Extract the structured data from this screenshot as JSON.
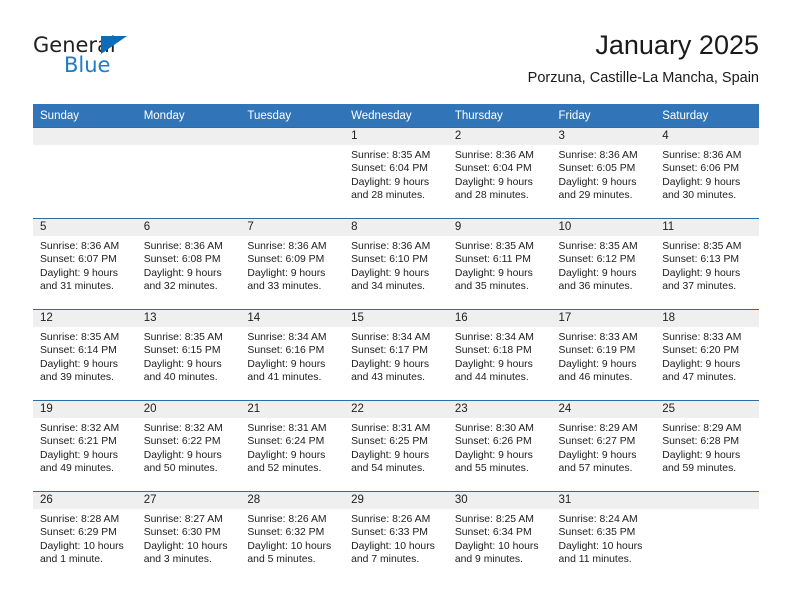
{
  "logo": {
    "text_primary": "General",
    "text_secondary": "Blue",
    "triangle_color": "#0e6cb6",
    "secondary_color": "#1c7cc6"
  },
  "header": {
    "title": "January 2025",
    "subtitle": "Porzuna, Castille-La Mancha, Spain"
  },
  "theme": {
    "header_blue": "#3175b8",
    "row_rule_blue": "#2e6da4",
    "daynum_band": "#efefef",
    "text": "#202020"
  },
  "calendar": {
    "weekday_headers": [
      "Sunday",
      "Monday",
      "Tuesday",
      "Wednesday",
      "Thursday",
      "Friday",
      "Saturday"
    ],
    "weeks": [
      [
        {
          "day": "",
          "sunrise": "",
          "sunset": "",
          "daylight_line1": "",
          "daylight_line2": "",
          "empty": true
        },
        {
          "day": "",
          "sunrise": "",
          "sunset": "",
          "daylight_line1": "",
          "daylight_line2": "",
          "empty": true
        },
        {
          "day": "",
          "sunrise": "",
          "sunset": "",
          "daylight_line1": "",
          "daylight_line2": "",
          "empty": true
        },
        {
          "day": "1",
          "sunrise": "Sunrise: 8:35 AM",
          "sunset": "Sunset: 6:04 PM",
          "daylight_line1": "Daylight: 9 hours",
          "daylight_line2": "and 28 minutes.",
          "empty": false
        },
        {
          "day": "2",
          "sunrise": "Sunrise: 8:36 AM",
          "sunset": "Sunset: 6:04 PM",
          "daylight_line1": "Daylight: 9 hours",
          "daylight_line2": "and 28 minutes.",
          "empty": false
        },
        {
          "day": "3",
          "sunrise": "Sunrise: 8:36 AM",
          "sunset": "Sunset: 6:05 PM",
          "daylight_line1": "Daylight: 9 hours",
          "daylight_line2": "and 29 minutes.",
          "empty": false
        },
        {
          "day": "4",
          "sunrise": "Sunrise: 8:36 AM",
          "sunset": "Sunset: 6:06 PM",
          "daylight_line1": "Daylight: 9 hours",
          "daylight_line2": "and 30 minutes.",
          "empty": false
        }
      ],
      [
        {
          "day": "5",
          "sunrise": "Sunrise: 8:36 AM",
          "sunset": "Sunset: 6:07 PM",
          "daylight_line1": "Daylight: 9 hours",
          "daylight_line2": "and 31 minutes.",
          "empty": false
        },
        {
          "day": "6",
          "sunrise": "Sunrise: 8:36 AM",
          "sunset": "Sunset: 6:08 PM",
          "daylight_line1": "Daylight: 9 hours",
          "daylight_line2": "and 32 minutes.",
          "empty": false
        },
        {
          "day": "7",
          "sunrise": "Sunrise: 8:36 AM",
          "sunset": "Sunset: 6:09 PM",
          "daylight_line1": "Daylight: 9 hours",
          "daylight_line2": "and 33 minutes.",
          "empty": false
        },
        {
          "day": "8",
          "sunrise": "Sunrise: 8:36 AM",
          "sunset": "Sunset: 6:10 PM",
          "daylight_line1": "Daylight: 9 hours",
          "daylight_line2": "and 34 minutes.",
          "empty": false
        },
        {
          "day": "9",
          "sunrise": "Sunrise: 8:35 AM",
          "sunset": "Sunset: 6:11 PM",
          "daylight_line1": "Daylight: 9 hours",
          "daylight_line2": "and 35 minutes.",
          "empty": false
        },
        {
          "day": "10",
          "sunrise": "Sunrise: 8:35 AM",
          "sunset": "Sunset: 6:12 PM",
          "daylight_line1": "Daylight: 9 hours",
          "daylight_line2": "and 36 minutes.",
          "empty": false
        },
        {
          "day": "11",
          "sunrise": "Sunrise: 8:35 AM",
          "sunset": "Sunset: 6:13 PM",
          "daylight_line1": "Daylight: 9 hours",
          "daylight_line2": "and 37 minutes.",
          "empty": false
        }
      ],
      [
        {
          "day": "12",
          "sunrise": "Sunrise: 8:35 AM",
          "sunset": "Sunset: 6:14 PM",
          "daylight_line1": "Daylight: 9 hours",
          "daylight_line2": "and 39 minutes.",
          "empty": false
        },
        {
          "day": "13",
          "sunrise": "Sunrise: 8:35 AM",
          "sunset": "Sunset: 6:15 PM",
          "daylight_line1": "Daylight: 9 hours",
          "daylight_line2": "and 40 minutes.",
          "empty": false
        },
        {
          "day": "14",
          "sunrise": "Sunrise: 8:34 AM",
          "sunset": "Sunset: 6:16 PM",
          "daylight_line1": "Daylight: 9 hours",
          "daylight_line2": "and 41 minutes.",
          "empty": false
        },
        {
          "day": "15",
          "sunrise": "Sunrise: 8:34 AM",
          "sunset": "Sunset: 6:17 PM",
          "daylight_line1": "Daylight: 9 hours",
          "daylight_line2": "and 43 minutes.",
          "empty": false
        },
        {
          "day": "16",
          "sunrise": "Sunrise: 8:34 AM",
          "sunset": "Sunset: 6:18 PM",
          "daylight_line1": "Daylight: 9 hours",
          "daylight_line2": "and 44 minutes.",
          "empty": false
        },
        {
          "day": "17",
          "sunrise": "Sunrise: 8:33 AM",
          "sunset": "Sunset: 6:19 PM",
          "daylight_line1": "Daylight: 9 hours",
          "daylight_line2": "and 46 minutes.",
          "empty": false
        },
        {
          "day": "18",
          "sunrise": "Sunrise: 8:33 AM",
          "sunset": "Sunset: 6:20 PM",
          "daylight_line1": "Daylight: 9 hours",
          "daylight_line2": "and 47 minutes.",
          "empty": false
        }
      ],
      [
        {
          "day": "19",
          "sunrise": "Sunrise: 8:32 AM",
          "sunset": "Sunset: 6:21 PM",
          "daylight_line1": "Daylight: 9 hours",
          "daylight_line2": "and 49 minutes.",
          "empty": false
        },
        {
          "day": "20",
          "sunrise": "Sunrise: 8:32 AM",
          "sunset": "Sunset: 6:22 PM",
          "daylight_line1": "Daylight: 9 hours",
          "daylight_line2": "and 50 minutes.",
          "empty": false
        },
        {
          "day": "21",
          "sunrise": "Sunrise: 8:31 AM",
          "sunset": "Sunset: 6:24 PM",
          "daylight_line1": "Daylight: 9 hours",
          "daylight_line2": "and 52 minutes.",
          "empty": false
        },
        {
          "day": "22",
          "sunrise": "Sunrise: 8:31 AM",
          "sunset": "Sunset: 6:25 PM",
          "daylight_line1": "Daylight: 9 hours",
          "daylight_line2": "and 54 minutes.",
          "empty": false
        },
        {
          "day": "23",
          "sunrise": "Sunrise: 8:30 AM",
          "sunset": "Sunset: 6:26 PM",
          "daylight_line1": "Daylight: 9 hours",
          "daylight_line2": "and 55 minutes.",
          "empty": false
        },
        {
          "day": "24",
          "sunrise": "Sunrise: 8:29 AM",
          "sunset": "Sunset: 6:27 PM",
          "daylight_line1": "Daylight: 9 hours",
          "daylight_line2": "and 57 minutes.",
          "empty": false
        },
        {
          "day": "25",
          "sunrise": "Sunrise: 8:29 AM",
          "sunset": "Sunset: 6:28 PM",
          "daylight_line1": "Daylight: 9 hours",
          "daylight_line2": "and 59 minutes.",
          "empty": false
        }
      ],
      [
        {
          "day": "26",
          "sunrise": "Sunrise: 8:28 AM",
          "sunset": "Sunset: 6:29 PM",
          "daylight_line1": "Daylight: 10 hours",
          "daylight_line2": "and 1 minute.",
          "empty": false
        },
        {
          "day": "27",
          "sunrise": "Sunrise: 8:27 AM",
          "sunset": "Sunset: 6:30 PM",
          "daylight_line1": "Daylight: 10 hours",
          "daylight_line2": "and 3 minutes.",
          "empty": false
        },
        {
          "day": "28",
          "sunrise": "Sunrise: 8:26 AM",
          "sunset": "Sunset: 6:32 PM",
          "daylight_line1": "Daylight: 10 hours",
          "daylight_line2": "and 5 minutes.",
          "empty": false
        },
        {
          "day": "29",
          "sunrise": "Sunrise: 8:26 AM",
          "sunset": "Sunset: 6:33 PM",
          "daylight_line1": "Daylight: 10 hours",
          "daylight_line2": "and 7 minutes.",
          "empty": false
        },
        {
          "day": "30",
          "sunrise": "Sunrise: 8:25 AM",
          "sunset": "Sunset: 6:34 PM",
          "daylight_line1": "Daylight: 10 hours",
          "daylight_line2": "and 9 minutes.",
          "empty": false
        },
        {
          "day": "31",
          "sunrise": "Sunrise: 8:24 AM",
          "sunset": "Sunset: 6:35 PM",
          "daylight_line1": "Daylight: 10 hours",
          "daylight_line2": "and 11 minutes.",
          "empty": false
        },
        {
          "day": "",
          "sunrise": "",
          "sunset": "",
          "daylight_line1": "",
          "daylight_line2": "",
          "empty": true
        }
      ]
    ]
  }
}
